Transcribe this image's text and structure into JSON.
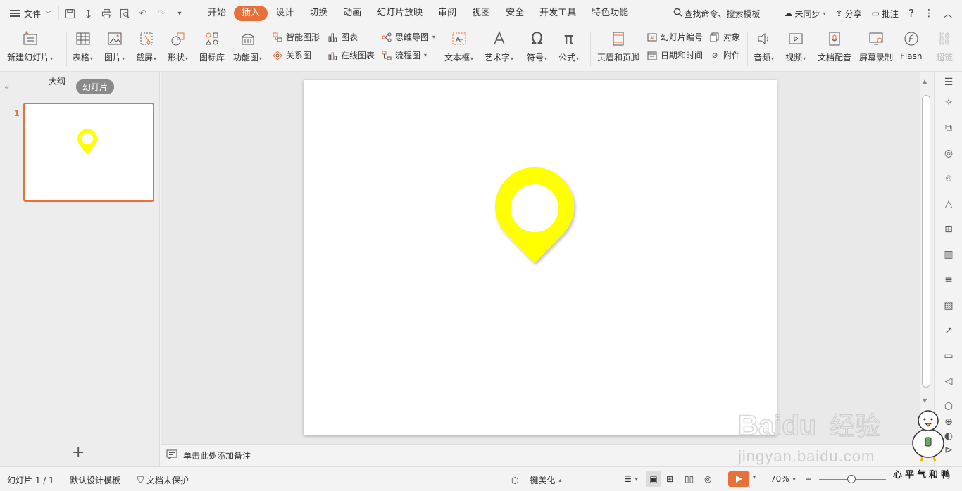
{
  "menubar": {
    "file_label": "文件",
    "tabs": [
      "开始",
      "插入",
      "设计",
      "切换",
      "动画",
      "幻灯片放映",
      "审阅",
      "视图",
      "安全",
      "开发工具",
      "特色功能"
    ],
    "active_tab": "插入",
    "search_label": "查找命令、搜索模板",
    "sync_label": "未同步",
    "share_label": "分享",
    "comment_label": "批注"
  },
  "ribbon": {
    "new_slide": "新建幻灯片",
    "table": "表格",
    "picture": "图片",
    "screenshot": "截屏",
    "shape": "形状",
    "icon_lib": "图标库",
    "func_chart": "功能图",
    "smart_art": "智能图形",
    "chart": "图表",
    "relation": "关系图",
    "online_chart": "在线图表",
    "mind_map": "思维导图",
    "flowchart": "流程图",
    "textbox": "文本框",
    "wordart": "艺术字",
    "symbol": "符号",
    "formula": "公式",
    "header_footer": "页眉和页脚",
    "slide_number": "幻灯片编号",
    "object": "对象",
    "date_time": "日期和时间",
    "attachment": "附件",
    "audio": "音频",
    "video": "视频",
    "doc_dub": "文档配音",
    "screen_rec": "屏幕录制",
    "flash": "Flash",
    "hyperlink": "超链"
  },
  "left_panel": {
    "outline_tab": "大纲",
    "slides_tab": "幻灯片",
    "slide_number": "1"
  },
  "notes": {
    "placeholder": "单击此处添加备注"
  },
  "status": {
    "slide_count": "幻灯片 1 / 1",
    "template": "默认设计模板",
    "protect": "文档未保护",
    "beautify": "一键美化",
    "zoom": "70%"
  },
  "colors": {
    "accent": "#e8703a",
    "pin": "#ffff00"
  },
  "watermark": {
    "brand": "Baidu经验",
    "url": "jingyan.baidu.com",
    "slogan": "心平气和鸭"
  }
}
